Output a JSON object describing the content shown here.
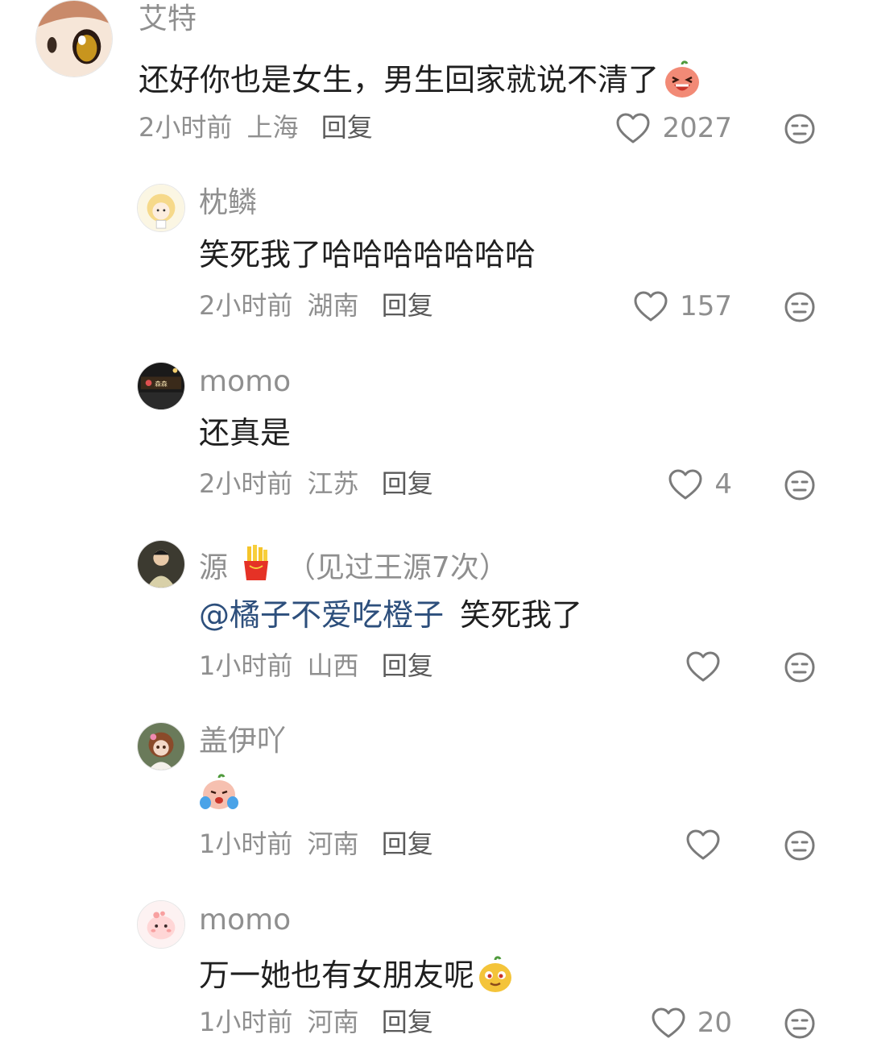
{
  "comments": [
    {
      "username": "艾特",
      "text": "还好你也是女生，男生回家就说不清了",
      "emoji": "laughing-peach-emoji",
      "time": "2小时前",
      "location": "上海",
      "reply_label": "回复",
      "likes": "2027",
      "avatar": "anime-eye-avatar"
    },
    {
      "username": "枕鳞",
      "text": "笑死我了哈哈哈哈哈哈哈",
      "time": "2小时前",
      "location": "湖南",
      "reply_label": "回复",
      "likes": "157",
      "avatar": "cartoon-girl-avatar"
    },
    {
      "username": "momo",
      "text": "还真是",
      "time": "2小时前",
      "location": "江苏",
      "reply_label": "回复",
      "likes": "4",
      "avatar": "storefront-avatar"
    },
    {
      "username": "源",
      "username_suffix": "（见过王源7次）",
      "name_emoji": "fries-emoji",
      "mention": "@橘子不爱吃橙子",
      "text": "笑死我了",
      "time": "1小时前",
      "location": "山西",
      "reply_label": "回复",
      "likes": "",
      "avatar": "person-photo-avatar"
    },
    {
      "username": "盖伊吖",
      "text": "",
      "emoji": "crying-peach-emoji",
      "time": "1小时前",
      "location": "河南",
      "reply_label": "回复",
      "likes": "",
      "avatar": "doll-avatar"
    },
    {
      "username": "momo",
      "text": "万一她也有女朋友呢",
      "emoji": "smug-mango-emoji",
      "time": "1小时前",
      "location": "河南",
      "reply_label": "回复",
      "likes": "20",
      "avatar": "pink-blob-avatar"
    }
  ],
  "colors": {
    "text": "#1f1f1f",
    "meta": "#8f8f8f",
    "mention": "#2d4f7c",
    "icon": "#7a7a7a"
  }
}
